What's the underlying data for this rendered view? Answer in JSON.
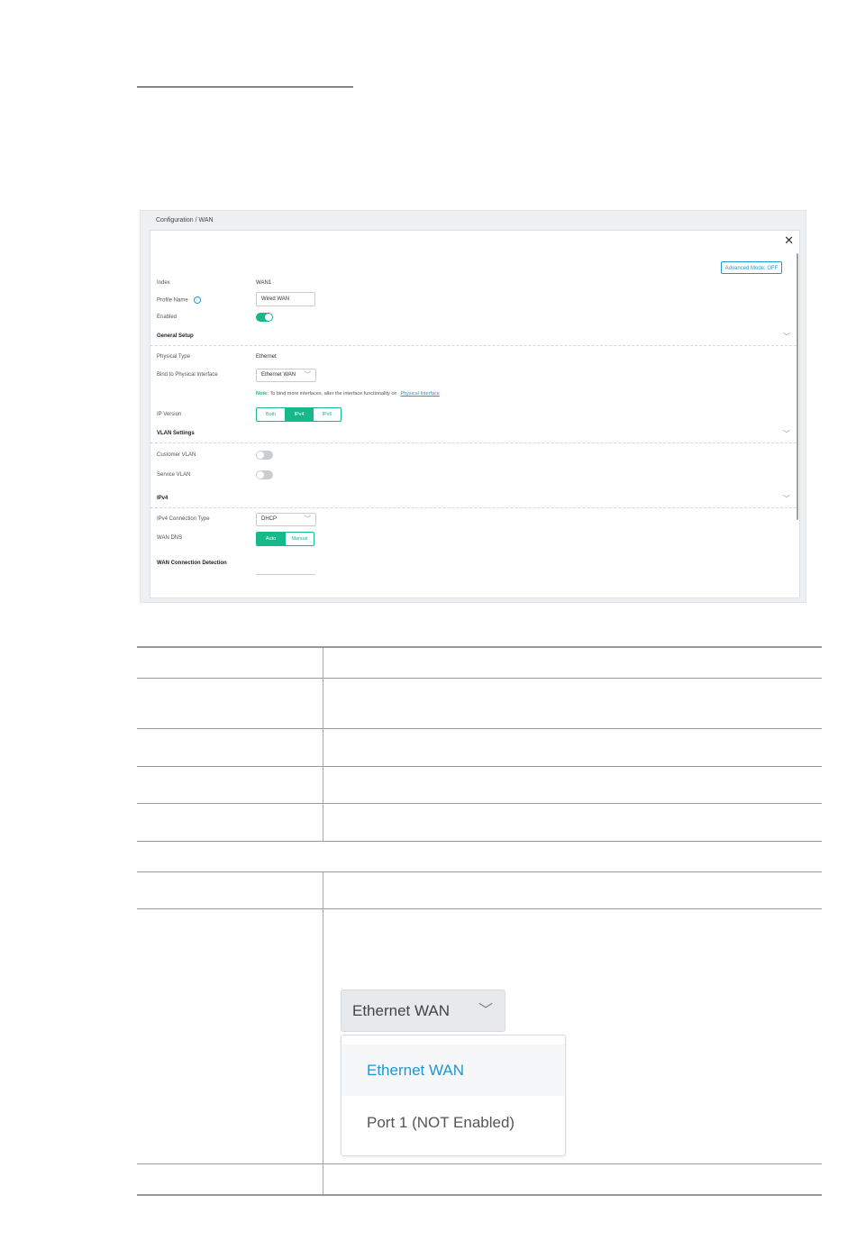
{
  "screenshot": {
    "breadcrumb": "Configuration / WAN",
    "close_glyph": "✕",
    "advanced_mode_label": "Advanced Mode: OFF",
    "fields": {
      "index_label": "Index",
      "index_value": "WAN1",
      "profile_name_label": "Profile Name",
      "profile_name_value": "Wired WAN",
      "enabled_label": "Enabled",
      "enabled": true
    },
    "general_setup": {
      "title": "General Setup",
      "physical_type_label": "Physical Type",
      "physical_type_value": "Ethernet",
      "bind_label": "Bind to Physical Interface",
      "bind_value": "Ethernet WAN",
      "note_prefix": "Note:",
      "note_text": "To bind more interfaces, alter the interface functionality on",
      "note_link": "Physical Interface",
      "ip_version_label": "IP Version",
      "ip_version_options": [
        "Both",
        "IPv4",
        "IPv6"
      ],
      "ip_version_selected": "IPv4"
    },
    "vlan_settings": {
      "title": "VLAN Settings",
      "customer_vlan_label": "Customer VLAN",
      "customer_vlan": false,
      "service_vlan_label": "Service VLAN",
      "service_vlan": false
    },
    "ipv4": {
      "title": "IPv4",
      "connection_type_label": "IPv4 Connection Type",
      "connection_type_value": "DHCP",
      "wan_dns_label": "WAN DNS",
      "wan_dns_options": [
        "Auto",
        "Manual"
      ],
      "wan_dns_selected": "Auto",
      "detection_label": "WAN Connection Detection"
    }
  },
  "zoomed_dropdown": {
    "selected_value": "Ethernet WAN",
    "options": [
      "Ethernet WAN",
      "Port 1 (NOT Enabled)"
    ],
    "highlighted_option": "Ethernet WAN"
  },
  "colors": {
    "accent_green": "#17b98a",
    "link_blue": "#2196d6"
  },
  "icons": {
    "close": "close-icon",
    "info": "info-icon",
    "chevron": "chevron-down-icon"
  }
}
